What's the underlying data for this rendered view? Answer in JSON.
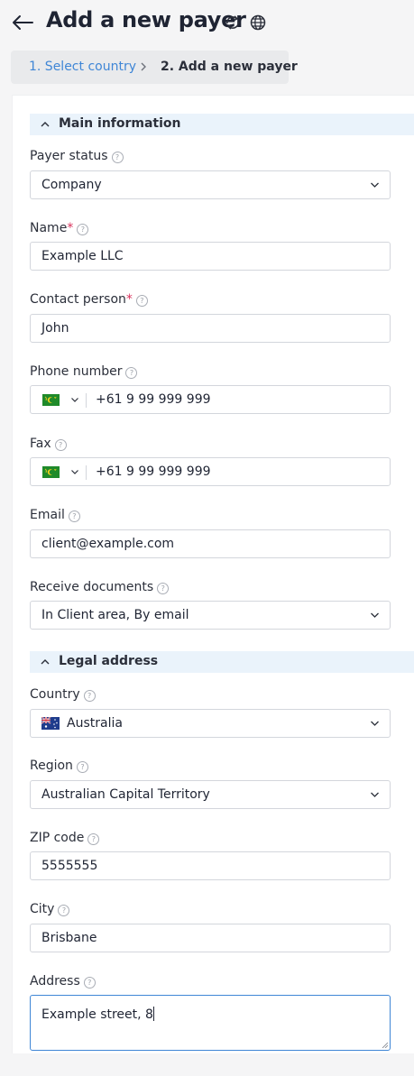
{
  "header": {
    "title": "Add a new payer",
    "icons": [
      "back-arrow-icon",
      "refresh-icon",
      "globe-icon"
    ]
  },
  "steps": [
    {
      "label": "1. Select country",
      "state": "link"
    },
    {
      "label": "2. Add a new payer",
      "state": "current"
    }
  ],
  "sections": {
    "main": {
      "title": "Main information"
    },
    "legal": {
      "title": "Legal address"
    }
  },
  "form": {
    "payer_status": {
      "label": "Payer status",
      "value": "Company"
    },
    "name": {
      "label": "Name",
      "required": "*",
      "value": "Example LLC"
    },
    "contact_person": {
      "label": "Contact person",
      "required": "*",
      "value": "John"
    },
    "phone": {
      "label": "Phone number",
      "value": "+61 9 99 999 999",
      "flag": "cocos-islands-flag"
    },
    "fax": {
      "label": "Fax",
      "value": "+61 9 99 999 999",
      "flag": "cocos-islands-flag"
    },
    "email": {
      "label": "Email",
      "value": "client@example.com"
    },
    "receive_documents": {
      "label": "Receive documents",
      "value": "In Client area, By email"
    },
    "country": {
      "label": "Country",
      "value": "Australia",
      "flag": "australia-flag"
    },
    "region": {
      "label": "Region",
      "value": "Australian Capital Territory"
    },
    "zip": {
      "label": "ZIP code",
      "value": "5555555"
    },
    "city": {
      "label": "City",
      "value": "Brisbane"
    },
    "address": {
      "label": "Address",
      "value": "Example street, 8"
    }
  },
  "help_glyph": "?",
  "colors": {
    "accent": "#3f86d6",
    "required": "#d9325d",
    "section_bg": "#eaf3fb",
    "steps_bg": "#e9eaec"
  }
}
